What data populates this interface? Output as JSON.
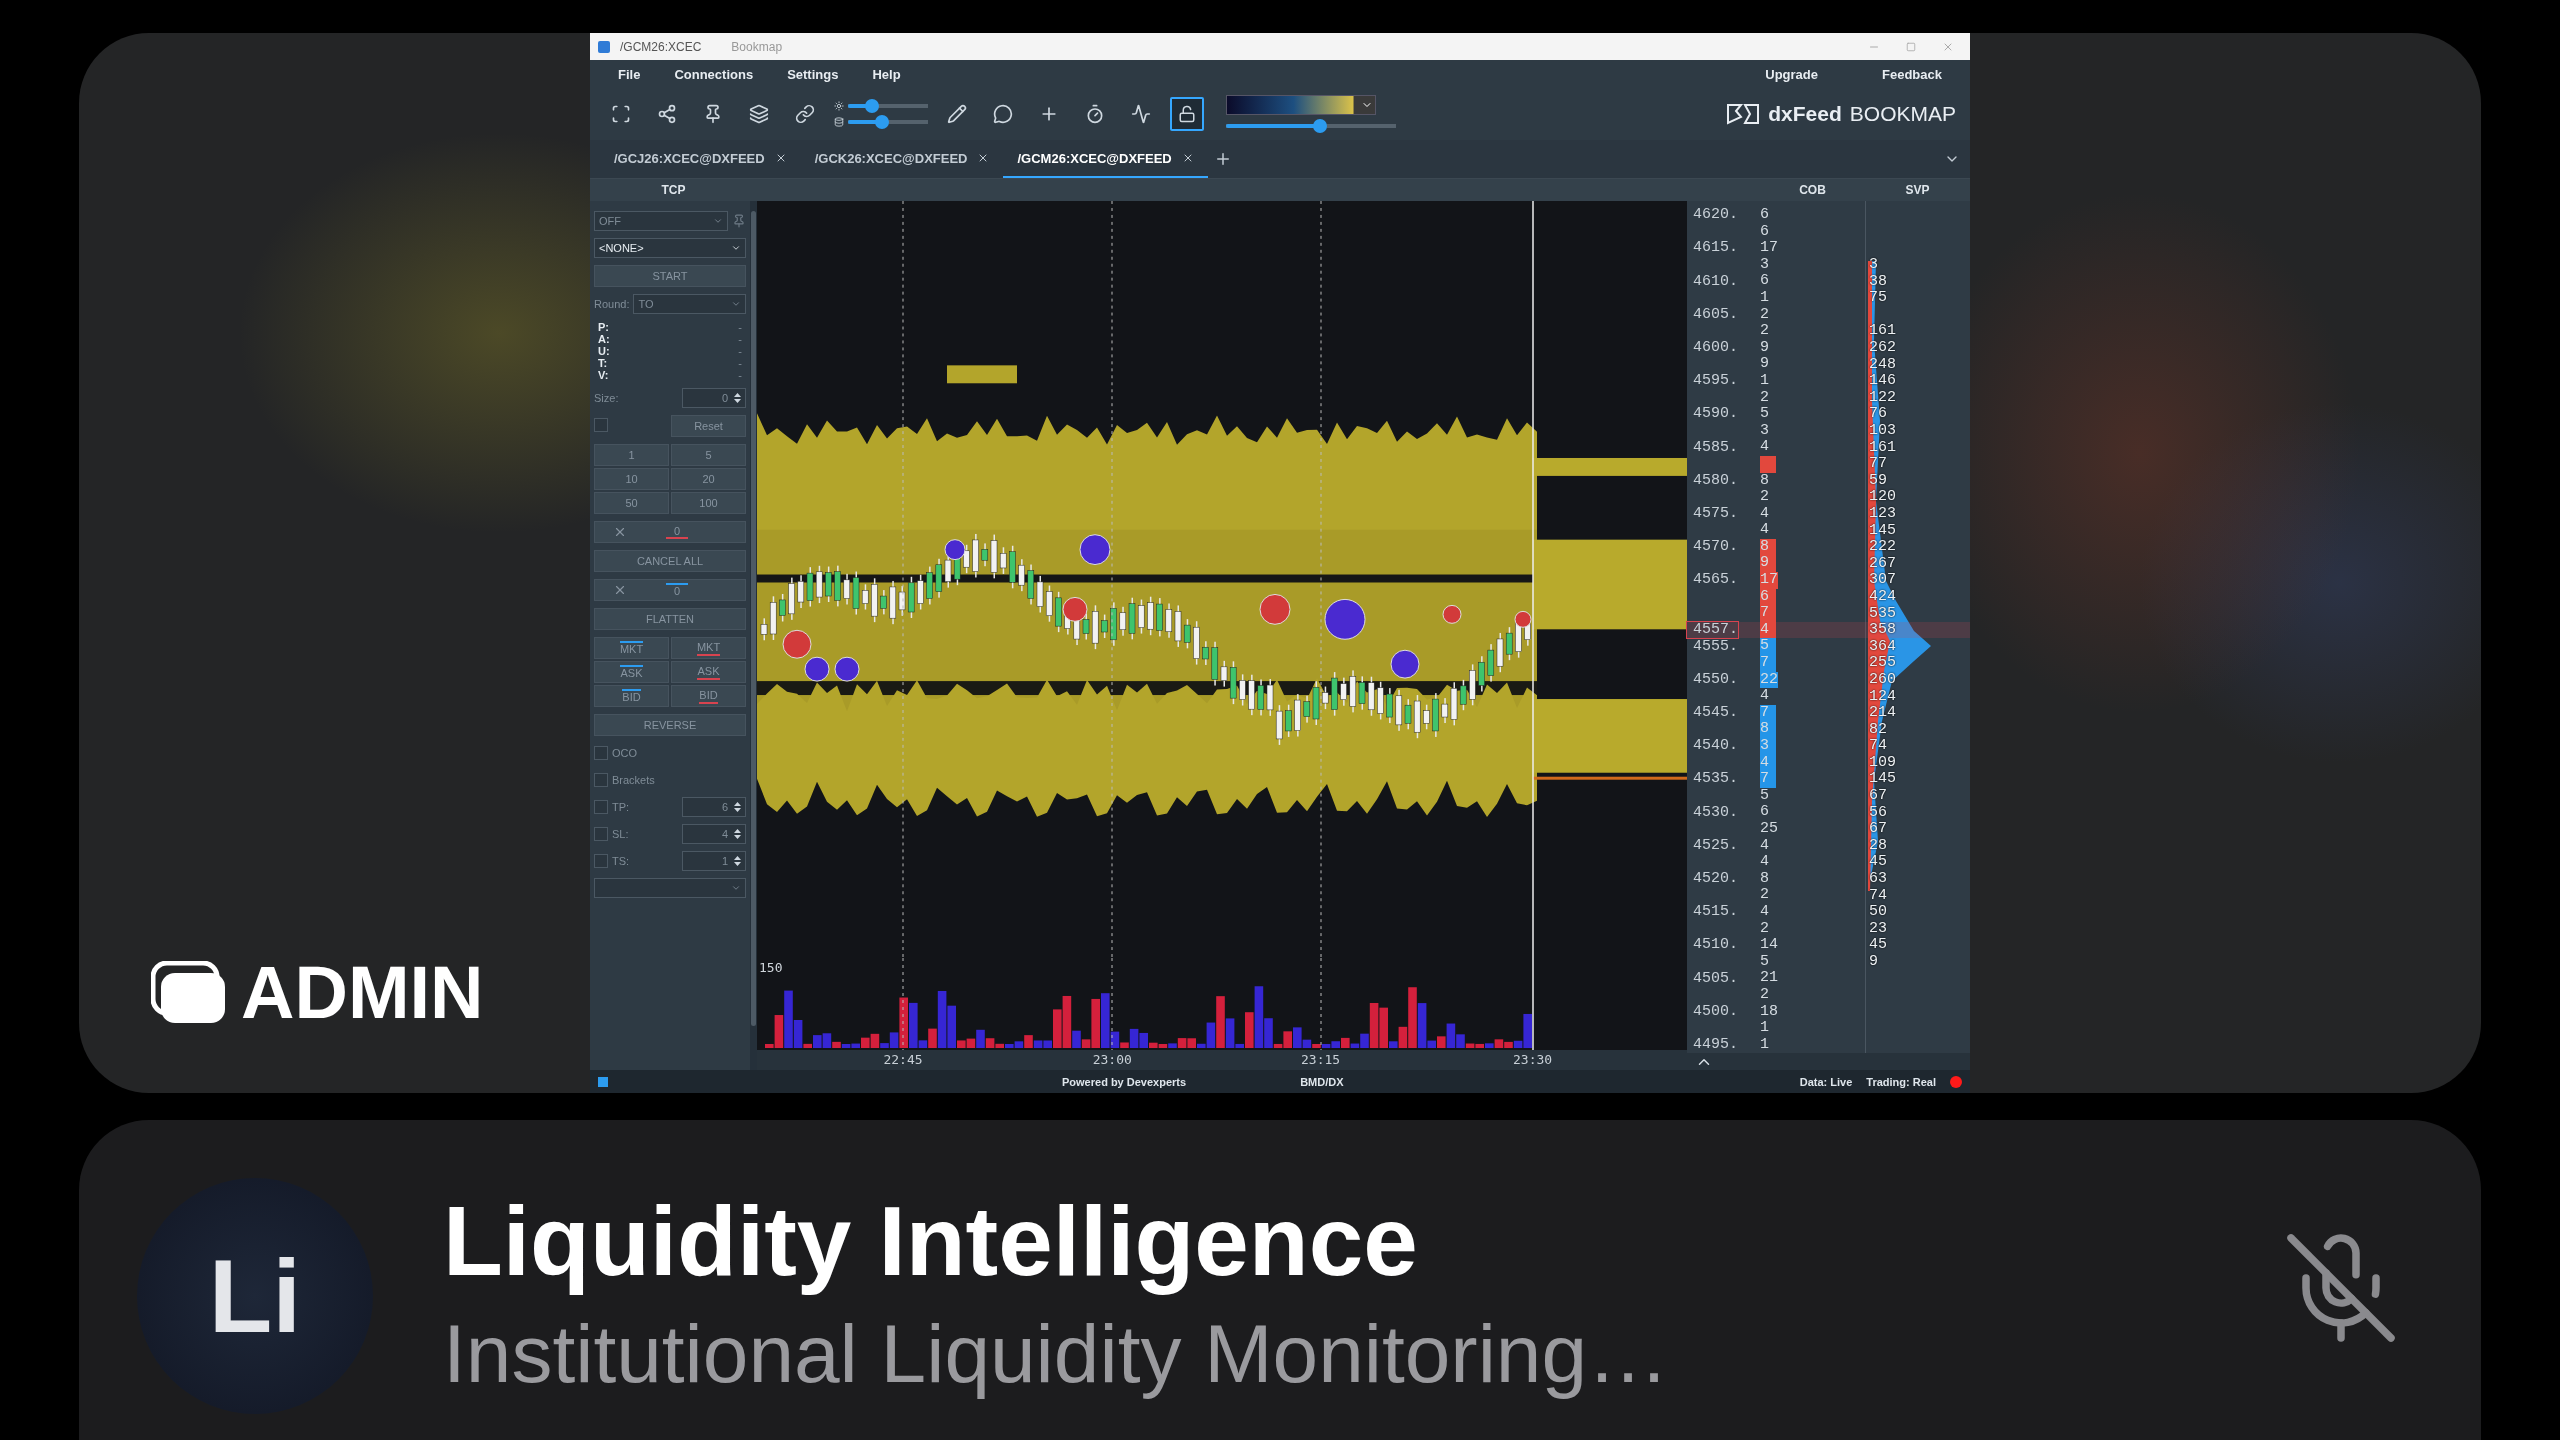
{
  "app_window": {
    "title": "/GCM26:XCEC",
    "app_name": "Bookmap",
    "menu": [
      "File",
      "Connections",
      "Settings",
      "Help"
    ],
    "menu_right": [
      "Upgrade",
      "Feedback"
    ],
    "toolbar": {
      "sliders": [
        {
          "level": 0.3
        },
        {
          "level": 0.42
        }
      ],
      "lock_selected": true,
      "gradient_slider": {
        "level": 0.55
      },
      "brand": "dxFeed",
      "brand_product": "BOOKMAP"
    },
    "tabs": [
      {
        "label": "/GCJ26:XCEC@DXFEED",
        "selected": false
      },
      {
        "label": "/GCK26:XCEC@DXFEED",
        "selected": false
      },
      {
        "label": "/GCM26:XCEC@DXFEED",
        "selected": true
      }
    ],
    "headers": {
      "tcp": "TCP",
      "cob": "COB",
      "svp": "SVP"
    },
    "tcp": {
      "mode": "OFF",
      "strategy": "<NONE>",
      "start": "START",
      "round_label": "Round:",
      "round_value": "TO",
      "stats": [
        {
          "label": "P:",
          "value": "-"
        },
        {
          "label": "A:",
          "value": "-"
        },
        {
          "label": "U:",
          "value": "-"
        },
        {
          "label": "T:",
          "value": "-"
        },
        {
          "label": "V:",
          "value": "-"
        }
      ],
      "size_label": "Size:",
      "size_value": "0",
      "reset_checked": false,
      "reset": "Reset",
      "quantities": [
        "1",
        "5",
        "10",
        "20",
        "50",
        "100"
      ],
      "sell_count": "0",
      "cancel_all": "CANCEL ALL",
      "buy_count": "0",
      "flatten": "FLATTEN",
      "orders": [
        {
          "label": "MKT",
          "kind": "buy"
        },
        {
          "label": "MKT",
          "kind": "sell"
        },
        {
          "label": "ASK",
          "kind": "buy"
        },
        {
          "label": "ASK",
          "kind": "sell"
        },
        {
          "label": "BID",
          "kind": "buy"
        },
        {
          "label": "BID",
          "kind": "sell"
        }
      ],
      "reverse": "REVERSE",
      "options": [
        {
          "label": "OCO",
          "checked": false
        },
        {
          "label": "Brackets",
          "checked": false
        }
      ],
      "brackets": [
        {
          "label": "TP:",
          "value": "6",
          "checked": false
        },
        {
          "label": "SL:",
          "value": "4",
          "checked": false
        },
        {
          "label": "TS:",
          "value": "1",
          "checked": false
        }
      ]
    },
    "chart": {
      "volume_tick": "150",
      "time_labels": [
        "22:45",
        "23:00",
        "23:15",
        "23:30"
      ]
    },
    "ladder": [
      {
        "price": "4620.",
        "cob": "6",
        "kind": "plain",
        "current": false
      },
      {
        "cob": "6",
        "kind": "plain",
        "current": false
      },
      {
        "price": "4615.",
        "cob": "17",
        "kind": "plain",
        "current": false
      },
      {
        "cob": "3",
        "kind": "plain",
        "svp": "3",
        "current": false
      },
      {
        "price": "4610.",
        "cob": "6",
        "kind": "plain",
        "svp": "38",
        "current": false
      },
      {
        "cob": "1",
        "kind": "plain",
        "svp": "75",
        "current": false
      },
      {
        "price": "4605.",
        "cob": "2",
        "kind": "plain",
        "current": false
      },
      {
        "cob": "2",
        "kind": "plain",
        "svp": "161",
        "current": false
      },
      {
        "price": "4600.",
        "cob": "9",
        "kind": "plain",
        "svp": "262",
        "current": false
      },
      {
        "cob": "9",
        "kind": "plain",
        "svp": "248",
        "current": false
      },
      {
        "price": "4595.",
        "cob": "1",
        "kind": "plain",
        "svp": "146",
        "current": false
      },
      {
        "cob": "2",
        "kind": "plain",
        "svp": "122",
        "current": false
      },
      {
        "price": "4590.",
        "cob": "5",
        "kind": "plain",
        "svp": "76",
        "current": false
      },
      {
        "cob": "3",
        "kind": "plain",
        "svp": "103",
        "current": false
      },
      {
        "price": "4585.",
        "cob": "4",
        "kind": "plain",
        "svp": "161",
        "current": false
      },
      {
        "kind": "ask",
        "svp": "77",
        "current": false
      },
      {
        "price": "4580.",
        "cob": "8",
        "kind": "plain",
        "svp": "59",
        "current": false
      },
      {
        "cob": "2",
        "kind": "plain",
        "svp": "120",
        "current": false
      },
      {
        "price": "4575.",
        "cob": "4",
        "kind": "plain",
        "svp": "123",
        "current": false
      },
      {
        "cob": "4",
        "kind": "plain",
        "svp": "145",
        "current": false
      },
      {
        "price": "4570.",
        "cob": "8",
        "kind": "ask",
        "svp": "222",
        "current": false
      },
      {
        "cob": "9",
        "kind": "ask",
        "svp": "267",
        "current": false
      },
      {
        "price": "4565.",
        "cob": "17",
        "kind": "ask",
        "svp": "307",
        "current": false
      },
      {
        "cob": "6",
        "kind": "ask",
        "svp": "424",
        "current": false
      },
      {
        "cob": "7",
        "kind": "ask",
        "svp": "535",
        "current": false
      },
      {
        "price": "4557.",
        "cob": "4",
        "kind": "ask",
        "svp": "358",
        "current": true
      },
      {
        "price": "4555.",
        "cob": "5",
        "kind": "bid",
        "svp": "364",
        "current": false
      },
      {
        "cob": "7",
        "kind": "bid",
        "svp": "255",
        "current": false
      },
      {
        "price": "4550.",
        "cob": "22",
        "kind": "bid",
        "svp": "260",
        "current": false
      },
      {
        "cob": "4",
        "kind": "plain",
        "svp": "124",
        "current": false
      },
      {
        "price": "4545.",
        "cob": "7",
        "kind": "bid",
        "svp": "214",
        "current": false
      },
      {
        "cob": "8",
        "kind": "bid",
        "svp": "82",
        "current": false
      },
      {
        "price": "4540.",
        "cob": "3",
        "kind": "bid",
        "svp": "74",
        "current": false
      },
      {
        "cob": "4",
        "kind": "bid",
        "svp": "109",
        "current": false
      },
      {
        "price": "4535.",
        "cob": "7",
        "kind": "bid",
        "svp": "145",
        "current": false
      },
      {
        "cob": "5",
        "kind": "plain",
        "svp": "67",
        "current": false
      },
      {
        "price": "4530.",
        "cob": "6",
        "kind": "plain",
        "svp": "56",
        "current": false
      },
      {
        "cob": "25",
        "kind": "plain",
        "svp": "67",
        "current": false
      },
      {
        "price": "4525.",
        "cob": "4",
        "kind": "plain",
        "svp": "28",
        "current": false
      },
      {
        "cob": "4",
        "kind": "plain",
        "svp": "45",
        "current": false
      },
      {
        "price": "4520.",
        "cob": "8",
        "kind": "plain",
        "svp": "63",
        "current": false
      },
      {
        "cob": "2",
        "kind": "plain",
        "svp": "74",
        "current": false
      },
      {
        "price": "4515.",
        "cob": "4",
        "kind": "plain",
        "svp": "50",
        "current": false
      },
      {
        "cob": "2",
        "kind": "plain",
        "svp": "23",
        "current": false
      },
      {
        "price": "4510.",
        "cob": "14",
        "kind": "plain",
        "svp": "45",
        "current": false
      },
      {
        "cob": "5",
        "kind": "plain",
        "svp": "9",
        "current": false
      },
      {
        "price": "4505.",
        "cob": "21",
        "kind": "plain",
        "current": false
      },
      {
        "cob": "2",
        "kind": "plain",
        "current": false
      },
      {
        "price": "4500.",
        "cob": "18",
        "kind": "plain",
        "current": false
      },
      {
        "cob": "1",
        "kind": "plain",
        "current": false
      },
      {
        "price": "4495.",
        "cob": "1",
        "kind": "plain",
        "current": false
      }
    ],
    "status_bar": {
      "credit": "Powered by Devexperts",
      "feed": "BMD/DX",
      "data": "Data: Live",
      "trading": "Trading: Real",
      "connected": true
    }
  },
  "tile_label": "ADMIN",
  "participant": {
    "initials": "Li",
    "name": "Liquidity Intelligence",
    "subtitle": "Institutional Liquidity Monitoring…",
    "muted": true
  }
}
